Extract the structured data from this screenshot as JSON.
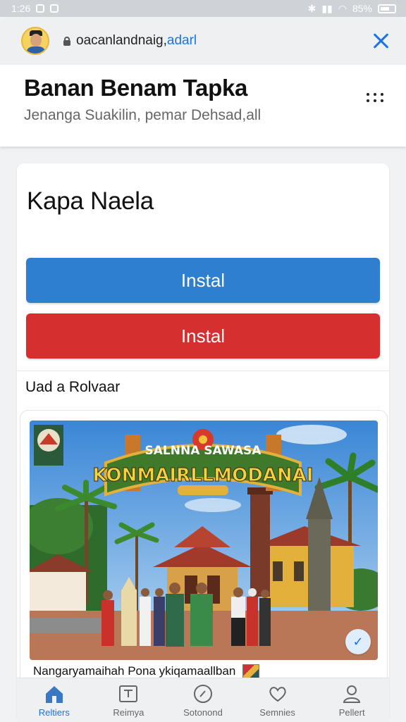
{
  "status_bar": {
    "time": "1:26",
    "battery": "85%"
  },
  "browser": {
    "url_prefix": "oacanlandnaig,",
    "url_domain": "adarl"
  },
  "header": {
    "title": "Banan Benam Tapka",
    "subtitle": "Jenanga Suakilin, pemar Dehsad,all"
  },
  "card": {
    "title": "Kapa Naela",
    "primary_button": "Instal",
    "secondary_button": "Instal",
    "section_label": "Uad a Rolvaar",
    "photo_sign_top": "SALNNA  SAWASA",
    "photo_sign_main": "KONMAIRLLMODANAI",
    "caption": "Nangaryamaihah Pona ykiqamaallban"
  },
  "nav": {
    "items": [
      {
        "label": "Reltiers",
        "icon": "home-icon",
        "active": true
      },
      {
        "label": "Reimya",
        "icon": "tab-icon",
        "active": false
      },
      {
        "label": "Sotonond",
        "icon": "compass-icon",
        "active": false
      },
      {
        "label": "Semnies",
        "icon": "heart-icon",
        "active": false
      },
      {
        "label": "Pellert",
        "icon": "profile-icon",
        "active": false
      }
    ]
  },
  "colors": {
    "accent": "#1a73e8",
    "primary_button": "#2f7fd1",
    "danger_button": "#d62f2f"
  }
}
